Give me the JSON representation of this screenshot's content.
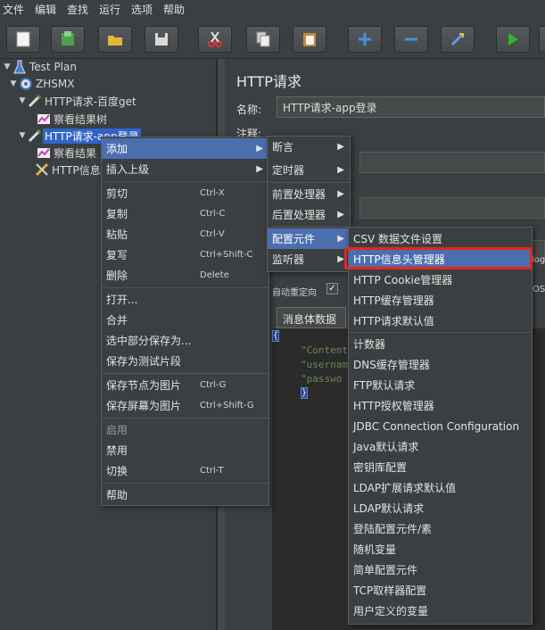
{
  "menubar": [
    "文件",
    "编辑",
    "查找",
    "运行",
    "选项",
    "帮助"
  ],
  "toolbar": {
    "icons": [
      "new-icon",
      "templates-icon",
      "open-icon",
      "save-icon",
      "cut-icon",
      "copy-icon",
      "paste-icon",
      "expand-icon",
      "collapse-icon",
      "toggle-icon",
      "run-icon"
    ]
  },
  "tree": {
    "test_plan": "Test Plan",
    "thread_group": "ZHSMX",
    "request1": "HTTP请求-百度get",
    "listener1": "察看结果树",
    "request2": "HTTP请求-app登录",
    "listener2": "察看结果",
    "header_mgr": "HTTP信息"
  },
  "panel": {
    "title": "HTTP请求",
    "name_label": "名称:",
    "name_value": "HTTP请求-app登录",
    "comment_label": "注释:",
    "redirect_text": "自动重定向",
    "post_text": "POST",
    "logo_text": "log",
    "body_tab": "消息体数据",
    "code_lines": [
      "\"Content",
      "\"usernam",
      "\"passwo"
    ],
    "brace_open": "{",
    "brace_close": "}"
  },
  "context_menu": {
    "items": [
      {
        "label": "添加",
        "shortcut": "",
        "submenu": true
      },
      {
        "label": "插入上级",
        "shortcut": "",
        "submenu": true
      },
      {
        "label": "剪切",
        "shortcut": "Ctrl-X"
      },
      {
        "label": "复制",
        "shortcut": "Ctrl-C"
      },
      {
        "label": "粘贴",
        "shortcut": "Ctrl-V"
      },
      {
        "label": "复写",
        "shortcut": "Ctrl+Shift-C"
      },
      {
        "label": "删除",
        "shortcut": "Delete"
      },
      {
        "label": "打开...",
        "shortcut": ""
      },
      {
        "label": "合并",
        "shortcut": ""
      },
      {
        "label": "选中部分保存为...",
        "shortcut": ""
      },
      {
        "label": "保存为测试片段",
        "shortcut": ""
      },
      {
        "label": "保存节点为图片",
        "shortcut": "Ctrl-G"
      },
      {
        "label": "保存屏幕为图片",
        "shortcut": "Ctrl+Shift-G"
      },
      {
        "label": "启用",
        "shortcut": ""
      },
      {
        "label": "禁用",
        "shortcut": ""
      },
      {
        "label": "切换",
        "shortcut": "Ctrl-T"
      },
      {
        "label": "帮助",
        "shortcut": ""
      }
    ]
  },
  "add_menu": {
    "items": [
      "断言",
      "定时器",
      "前置处理器",
      "后置处理器",
      "配置元件",
      "监听器"
    ]
  },
  "config_menu": {
    "items": [
      "CSV 数据文件设置",
      "HTTP信息头管理器",
      "HTTP Cookie管理器",
      "HTTP缓存管理器",
      "HTTP请求默认值",
      "计数器",
      "DNS缓存管理器",
      "FTP默认请求",
      "HTTP授权管理器",
      "JDBC Connection Configuration",
      "Java默认请求",
      "密钥库配置",
      "LDAP扩展请求默认值",
      "LDAP默认请求",
      "登陆配置元件/素",
      "随机变量",
      "简单配置元件",
      "TCP取样器配置",
      "用户定义的变量"
    ]
  },
  "colors": {
    "highlight": "#4b6eaf",
    "selection": "#2f65ca",
    "annotation_red": "#e8261c"
  }
}
